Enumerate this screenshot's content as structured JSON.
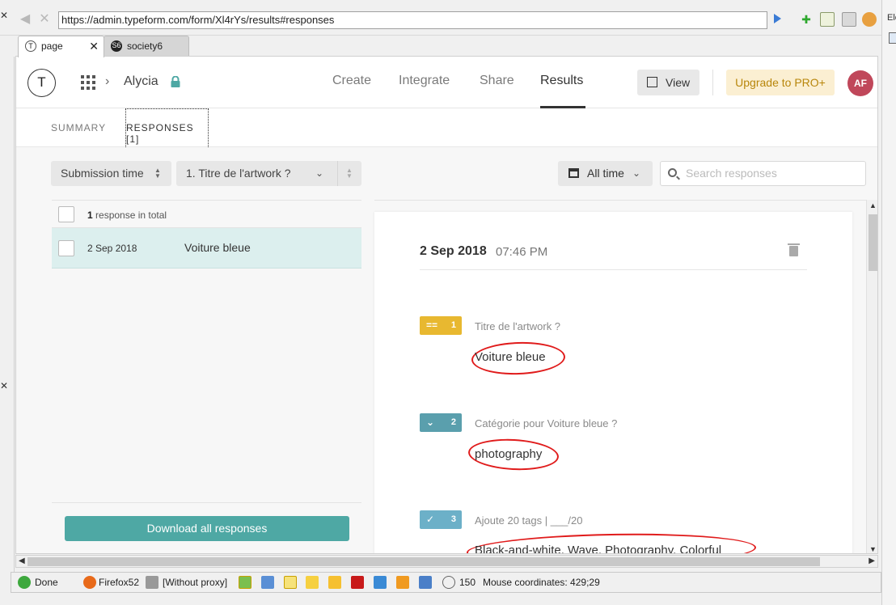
{
  "browser": {
    "url": "https://admin.typeform.com/form/Xl4rYs/results#responses",
    "tabs": [
      {
        "label": "page",
        "icon": "T"
      },
      {
        "label": "society6",
        "icon": "S6"
      }
    ],
    "right_panel_label": "Ele"
  },
  "app": {
    "logo": "T",
    "workspace": "Alycia",
    "nav": [
      "Create",
      "Integrate",
      "Share",
      "Results"
    ],
    "active_nav": "Results",
    "view_label": "View",
    "upgrade_label": "Upgrade to PRO+",
    "avatar_initials": "AF",
    "accent": "#4ea8a4"
  },
  "subtabs": {
    "summary": "SUMMARY",
    "responses": "RESPONSES [1]"
  },
  "toolbar": {
    "sort_label": "Submission time",
    "question_select": "1. Titre de l'artwork ?",
    "time_filter": "All time",
    "search_placeholder": "Search responses"
  },
  "list": {
    "total_count": "1",
    "total_suffix": " response in total",
    "rows": [
      {
        "date": "2 Sep 2018",
        "value": "Voiture bleue"
      }
    ],
    "download_label": "Download all responses"
  },
  "detail": {
    "date": "2 Sep 2018",
    "time": "07:46 PM",
    "questions": [
      {
        "number": "1",
        "title": "Titre de l'artwork ?",
        "answer": "Voiture bleue",
        "color": "#e8b830",
        "icon": "short-text-icon"
      },
      {
        "number": "2",
        "title": "Catégorie pour Voiture bleue ?",
        "answer": "photography",
        "color": "#5a9fad",
        "icon": "dropdown-icon"
      },
      {
        "number": "3",
        "title": "Ajoute 20 tags | ___/20",
        "answer": "Black-and-white, Wave, Photography, Colorful",
        "color": "#6cb0c8",
        "icon": "checkmark-icon"
      }
    ]
  },
  "statusbar": {
    "status": "Done",
    "browser_name": "Firefox52",
    "proxy": "[Without proxy]",
    "count": "150",
    "mouse": "Mouse coordinates: 429;29"
  }
}
